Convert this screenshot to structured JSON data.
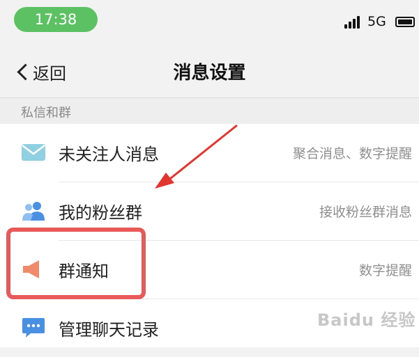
{
  "status_bar": {
    "time": "17:38",
    "network": "5G"
  },
  "nav": {
    "back_label": "返回",
    "title": "消息设置"
  },
  "section": {
    "label": "私信和群"
  },
  "rows": [
    {
      "label": "未关注人消息",
      "detail": "聚合消息、数字提醒",
      "icon": "mail-icon"
    },
    {
      "label": "我的粉丝群",
      "detail": "接收粉丝群消息",
      "icon": "people-icon"
    },
    {
      "label": "群通知",
      "detail": "数字提醒",
      "icon": "speaker-icon"
    },
    {
      "label": "管理聊天记录",
      "detail": "",
      "icon": "chat-icon"
    }
  ],
  "colors": {
    "accent_green": "#5cc163",
    "highlight_red": "#e85a5a",
    "icon_blue": "#4a90e2",
    "icon_orange": "#ef8a6a"
  }
}
